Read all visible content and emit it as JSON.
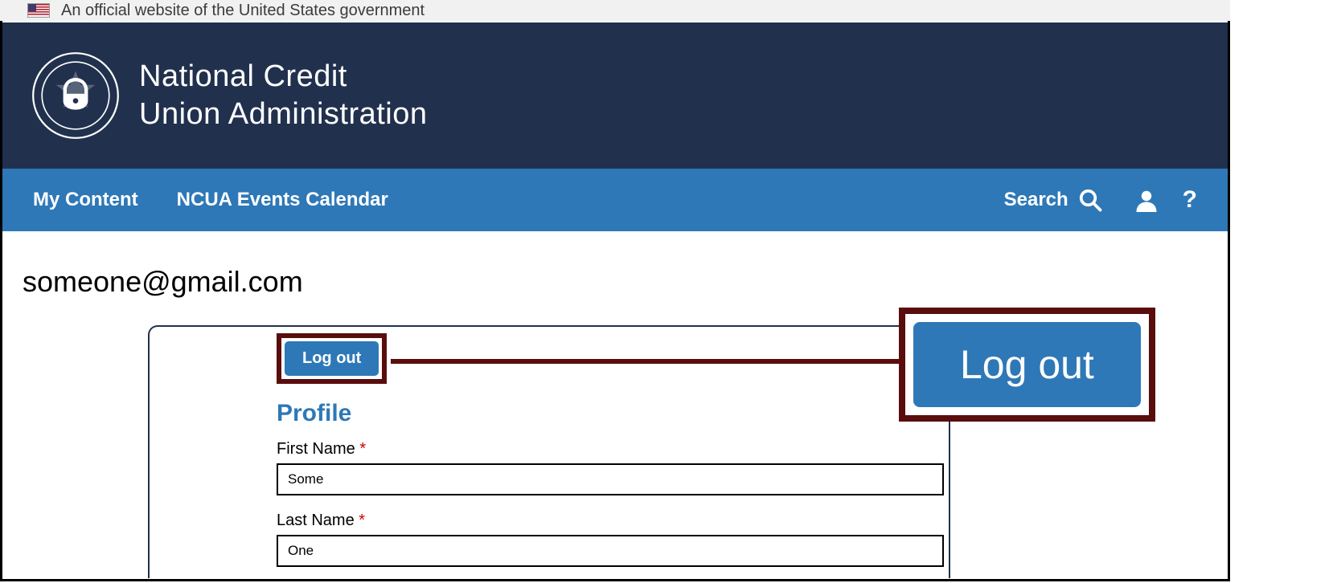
{
  "gov_banner": {
    "text": "An official website of the United States government"
  },
  "header": {
    "agency_line1": "National Credit",
    "agency_line2": "Union Administration"
  },
  "nav": {
    "my_content": "My Content",
    "events_calendar": "NCUA Events Calendar",
    "search_label": "Search",
    "help_label": "?"
  },
  "user": {
    "email": "someone@gmail.com"
  },
  "actions": {
    "logout_label": "Log out",
    "logout_callout_label": "Log out"
  },
  "profile": {
    "heading": "Profile",
    "first_name_label": "First Name",
    "first_name_value": "Some",
    "last_name_label": "Last Name",
    "last_name_value": "One",
    "required_mark": "*"
  }
}
